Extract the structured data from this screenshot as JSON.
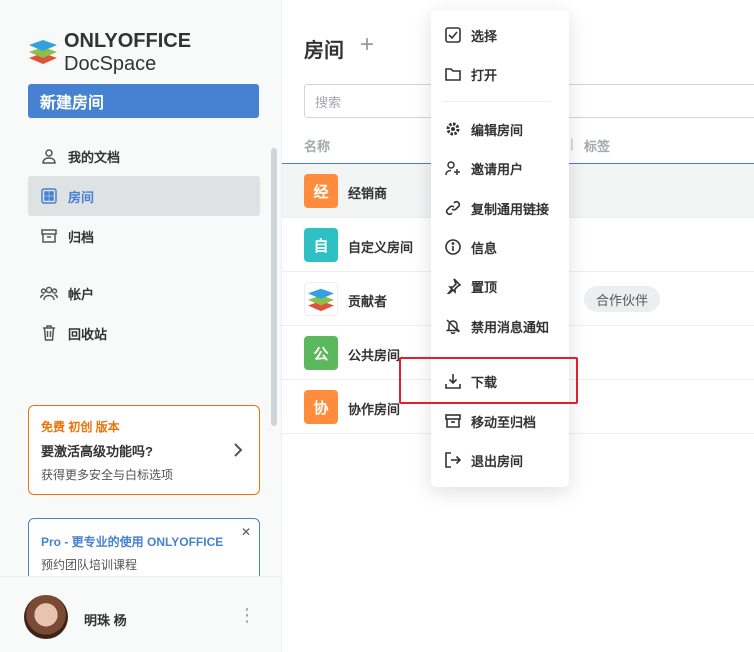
{
  "sidebar": {
    "logo": {
      "brand": "ONLYOFFICE",
      "product": "DocSpace"
    },
    "new_room_label": "新建房间",
    "nav": [
      {
        "label": "我的文档",
        "icon": "person-icon"
      },
      {
        "label": "房间",
        "icon": "rooms-icon",
        "active": true
      },
      {
        "label": "归档",
        "icon": "archive-icon"
      },
      {
        "label": "帐户",
        "icon": "accounts-icon"
      },
      {
        "label": "回收站",
        "icon": "trash-icon"
      }
    ],
    "promo": {
      "tag": "免费 初创 版本",
      "title": "要激活高级功能吗?",
      "subtitle": "获得更多安全与白标选项"
    },
    "pro": {
      "title": "Pro - 更专业的使用 ONLYOFFICE",
      "subtitle": "预约团队培训课程"
    },
    "profile": {
      "name": "明珠 杨"
    }
  },
  "main": {
    "title": "房间",
    "search_placeholder": "搜索",
    "columns": {
      "name": "名称",
      "tags": "标签"
    },
    "rooms": [
      {
        "icon_letter": "经",
        "name": "经销商",
        "color": "#ff8c3c",
        "tag": ""
      },
      {
        "icon_letter": "自",
        "name": "自定义房间",
        "color": "#2fc0c4",
        "tag": ""
      },
      {
        "icon_letter": "",
        "name": "贡献者",
        "color": "logo",
        "tag": "合作伙伴"
      },
      {
        "icon_letter": "公",
        "name": "公共房间",
        "color": "#5cb85c",
        "tag": ""
      },
      {
        "icon_letter": "协",
        "name": "协作房间",
        "color": "#ff8c3c",
        "tag": ""
      }
    ]
  },
  "context_menu": {
    "items": [
      {
        "label": "选择",
        "icon": "checkbox-icon"
      },
      {
        "label": "打开",
        "icon": "folder-icon"
      },
      {
        "label": "编辑房间",
        "icon": "gear-icon"
      },
      {
        "label": "邀请用户",
        "icon": "add-user-icon"
      },
      {
        "label": "复制通用链接",
        "icon": "link-icon"
      },
      {
        "label": "信息",
        "icon": "info-icon"
      },
      {
        "label": "置顶",
        "icon": "pin-icon"
      },
      {
        "label": "禁用消息通知",
        "icon": "mute-icon"
      },
      {
        "label": "下载",
        "icon": "download-icon"
      },
      {
        "label": "移动至归档",
        "icon": "archive-icon"
      },
      {
        "label": "退出房间",
        "icon": "exit-icon"
      }
    ]
  },
  "colors": {
    "accent": "#4781d1",
    "promo": "#ed7309",
    "highlight": "#e2202b"
  }
}
